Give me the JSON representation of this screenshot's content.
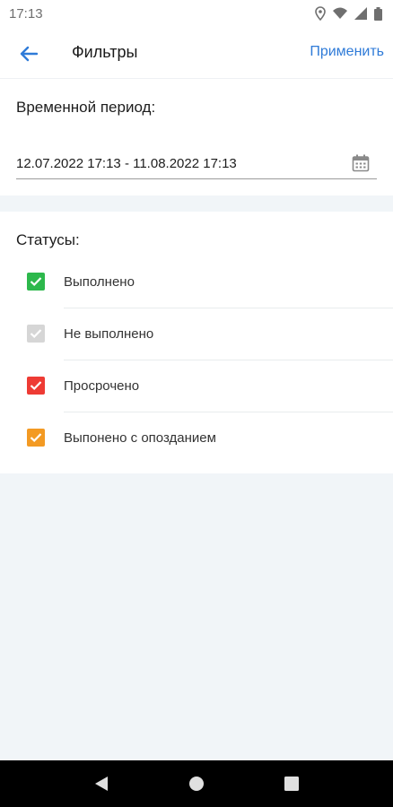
{
  "status_bar": {
    "time": "17:13",
    "icons": [
      "location-icon",
      "wifi-icon",
      "signal-icon",
      "battery-icon"
    ]
  },
  "app_bar": {
    "back_icon": "arrow-left-icon",
    "title": "Фильтры",
    "apply_label": "Применить"
  },
  "period": {
    "title": "Временной период:",
    "value": "12.07.2022 17:13 - 11.08.2022 17:13",
    "icon": "calendar-icon"
  },
  "statuses": {
    "title": "Статусы:",
    "items": [
      {
        "label": "Выполнено",
        "checked": true,
        "color": "#2db84c"
      },
      {
        "label": "Не выполнено",
        "checked": true,
        "color": "#d6d6d6"
      },
      {
        "label": "Просрочено",
        "checked": true,
        "color": "#ee3b34"
      },
      {
        "label": "Выпонено с опозданием",
        "checked": true,
        "color": "#f39a23"
      }
    ]
  },
  "colors": {
    "accent": "#2f7bd8",
    "background": "#f1f5f8"
  },
  "nav_bar": {
    "icons": [
      "back-triangle-icon",
      "home-circle-icon",
      "recents-square-icon"
    ]
  }
}
